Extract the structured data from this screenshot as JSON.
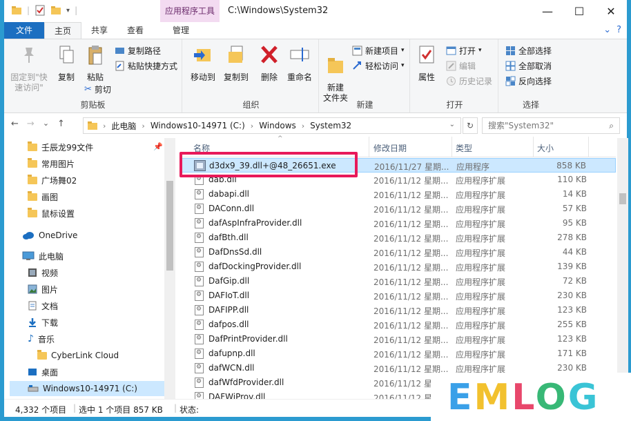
{
  "titlebar": {
    "context_tab": "应用程序工具",
    "title": "C:\\Windows\\System32",
    "minimize": "—",
    "maximize": "☐",
    "close": "✕"
  },
  "tabs": {
    "file": "文件",
    "home": "主页",
    "share": "共享",
    "view": "查看",
    "manage": "管理"
  },
  "ribbon": {
    "clipboard": {
      "pin": "固定到\"快速访问\"",
      "copy": "复制",
      "paste": "粘贴",
      "copy_path": "复制路径",
      "paste_shortcut": "粘贴快捷方式",
      "cut": "剪切",
      "label": "剪贴板"
    },
    "organize": {
      "move_to": "移动到",
      "copy_to": "复制到",
      "delete": "删除",
      "rename": "重命名",
      "label": "组织"
    },
    "new": {
      "new_folder": "新建\n文件夹",
      "new_item": "新建项目",
      "easy_access": "轻松访问",
      "label": "新建"
    },
    "open": {
      "properties": "属性",
      "open": "打开",
      "edit": "编辑",
      "history": "历史记录",
      "label": "打开"
    },
    "select": {
      "select_all": "全部选择",
      "select_none": "全部取消",
      "invert": "反向选择",
      "label": "选择"
    }
  },
  "address": {
    "back": "←",
    "forward": "→",
    "recent": "⌄",
    "up": "↑",
    "crumbs": [
      "此电脑",
      "Windows10-14971 (C:)",
      "Windows",
      "System32"
    ],
    "search_placeholder": "搜索\"System32\""
  },
  "nav_pane": {
    "quick_access": [
      "壬辰龙99文件",
      "常用图片",
      "广场舞02",
      "画图",
      "鼠标设置"
    ],
    "onedrive": "OneDrive",
    "this_pc": "此电脑",
    "pc_items": [
      "视频",
      "图片",
      "文档",
      "下载",
      "音乐",
      "CyberLink Cloud",
      "桌面",
      "Windows10-14971 (C:)"
    ]
  },
  "columns": {
    "name": "名称",
    "date": "修改日期",
    "type": "类型",
    "size": "大小"
  },
  "files": [
    {
      "name": "d3dx9_39.dll+@48_26651.exe",
      "date": "2016/11/27 星期...",
      "type": "应用程序",
      "size": "858 KB"
    },
    {
      "name": "dab.dll",
      "date": "2016/11/12 星期...",
      "type": "应用程序扩展",
      "size": "110 KB"
    },
    {
      "name": "dabapi.dll",
      "date": "2016/11/12 星期...",
      "type": "应用程序扩展",
      "size": "14 KB"
    },
    {
      "name": "DAConn.dll",
      "date": "2016/11/12 星期...",
      "type": "应用程序扩展",
      "size": "57 KB"
    },
    {
      "name": "dafAspInfraProvider.dll",
      "date": "2016/11/12 星期...",
      "type": "应用程序扩展",
      "size": "95 KB"
    },
    {
      "name": "dafBth.dll",
      "date": "2016/11/12 星期...",
      "type": "应用程序扩展",
      "size": "278 KB"
    },
    {
      "name": "DafDnsSd.dll",
      "date": "2016/11/12 星期...",
      "type": "应用程序扩展",
      "size": "44 KB"
    },
    {
      "name": "dafDockingProvider.dll",
      "date": "2016/11/12 星期...",
      "type": "应用程序扩展",
      "size": "139 KB"
    },
    {
      "name": "DafGip.dll",
      "date": "2016/11/12 星期...",
      "type": "应用程序扩展",
      "size": "72 KB"
    },
    {
      "name": "DAFIoT.dll",
      "date": "2016/11/12 星期...",
      "type": "应用程序扩展",
      "size": "230 KB"
    },
    {
      "name": "DAFIPP.dll",
      "date": "2016/11/12 星期...",
      "type": "应用程序扩展",
      "size": "123 KB"
    },
    {
      "name": "dafpos.dll",
      "date": "2016/11/12 星期...",
      "type": "应用程序扩展",
      "size": "255 KB"
    },
    {
      "name": "DafPrintProvider.dll",
      "date": "2016/11/12 星期...",
      "type": "应用程序扩展",
      "size": "123 KB"
    },
    {
      "name": "dafupnp.dll",
      "date": "2016/11/12 星期...",
      "type": "应用程序扩展",
      "size": "171 KB"
    },
    {
      "name": "dafWCN.dll",
      "date": "2016/11/12 星期...",
      "type": "应用程序扩展",
      "size": "230 KB"
    },
    {
      "name": "dafWfdProvider.dll",
      "date": "2016/11/12 星期...",
      "type": "应用程序扩展",
      "size": ""
    },
    {
      "name": "DAFWiProv.dll",
      "date": "2016/11/12 星期...",
      "type": "应用程序扩展",
      "size": ""
    }
  ],
  "status": {
    "count": "4,332 个项目",
    "selection": "选中 1 个项目  857 KB",
    "state": "状态:"
  },
  "watermark": {
    "text": "EMLOG",
    "colors": [
      "#3aa0e8",
      "#f2c12e",
      "#e8476b",
      "#38b876",
      "#3ac4d6"
    ]
  },
  "colors": {
    "frame": "#2b9bd0",
    "file_tab": "#1c6fc1",
    "context_tab": "#f3dbf1",
    "selection": "#cce8ff",
    "highlight_box": "#e8195a"
  }
}
